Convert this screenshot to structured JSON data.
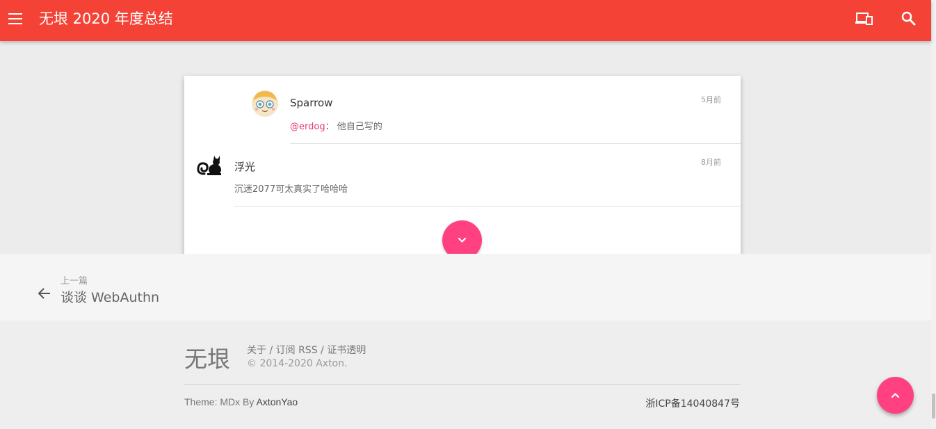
{
  "appbar": {
    "title": "无垠 2020 年度总结",
    "menu_icon": "menu-icon",
    "devices_icon": "devices-icon",
    "search_icon": "search-icon",
    "color": "#f44336"
  },
  "comments": [
    {
      "name": "Sparrow",
      "time": "5月前",
      "mention": "@erdog",
      "separator": "：",
      "text": "他自己写的"
    },
    {
      "name": "浮光",
      "time": "8月前",
      "text": "沉迷2077可太真实了哈哈哈"
    }
  ],
  "more_button": {
    "icon": "chevron-down-icon",
    "color": "#ff4081"
  },
  "prev_post": {
    "label": "上一篇",
    "title": "谈谈 WebAuthn",
    "icon": "arrow-left-icon"
  },
  "footer": {
    "brand": "无垠",
    "links": [
      "关于",
      "订阅 RSS",
      "证书透明"
    ],
    "link_separator": " / ",
    "copyright": "© 2014-2020 Axton.",
    "theme_prefix": "Theme: MDx By ",
    "theme_author": "AxtonYao",
    "icp": "浙ICP备14040847号"
  },
  "top_button": {
    "icon": "chevron-up-icon",
    "color": "#ff4081"
  }
}
